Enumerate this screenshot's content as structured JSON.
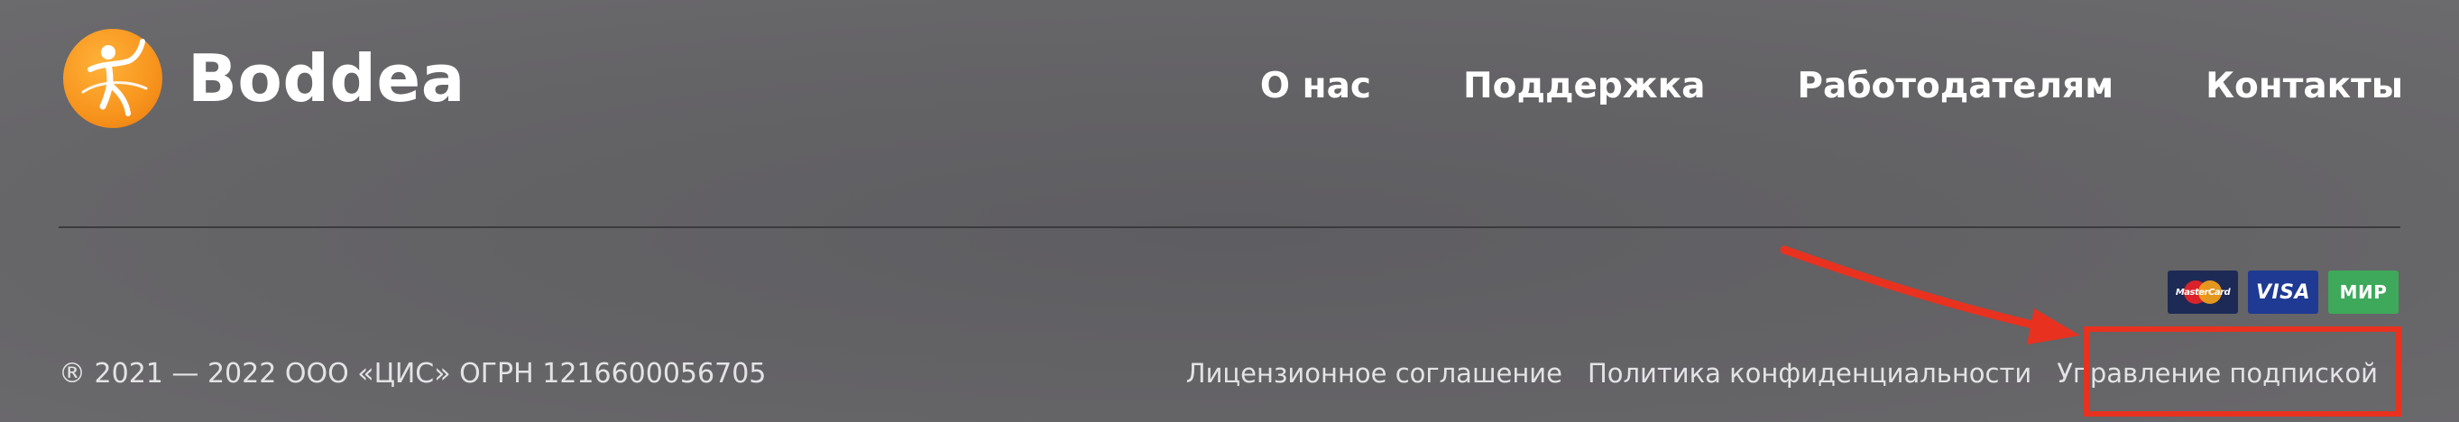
{
  "brand": {
    "name": "Boddea"
  },
  "nav": {
    "items": [
      {
        "label": "О нас"
      },
      {
        "label": "Поддержка"
      },
      {
        "label": "Работодателям"
      },
      {
        "label": "Контакты"
      }
    ]
  },
  "footer": {
    "copyright": "® 2021 — 2022 ООО «ЦИС» ОГРН 1216600056705",
    "links": [
      {
        "label": "Лицензионное соглашение"
      },
      {
        "label": "Политика конфиденциальности"
      },
      {
        "label": "Управление подпиской"
      }
    ],
    "payments": [
      {
        "name": "MasterCard",
        "label": "MasterCard"
      },
      {
        "name": "Visa",
        "label": "VISA"
      },
      {
        "name": "Mir",
        "label": "МИР"
      }
    ]
  },
  "annotation": {
    "color": "#e8321f"
  },
  "colors": {
    "logo": "#f7941d",
    "background": "#646366",
    "text": "#ffffff"
  }
}
